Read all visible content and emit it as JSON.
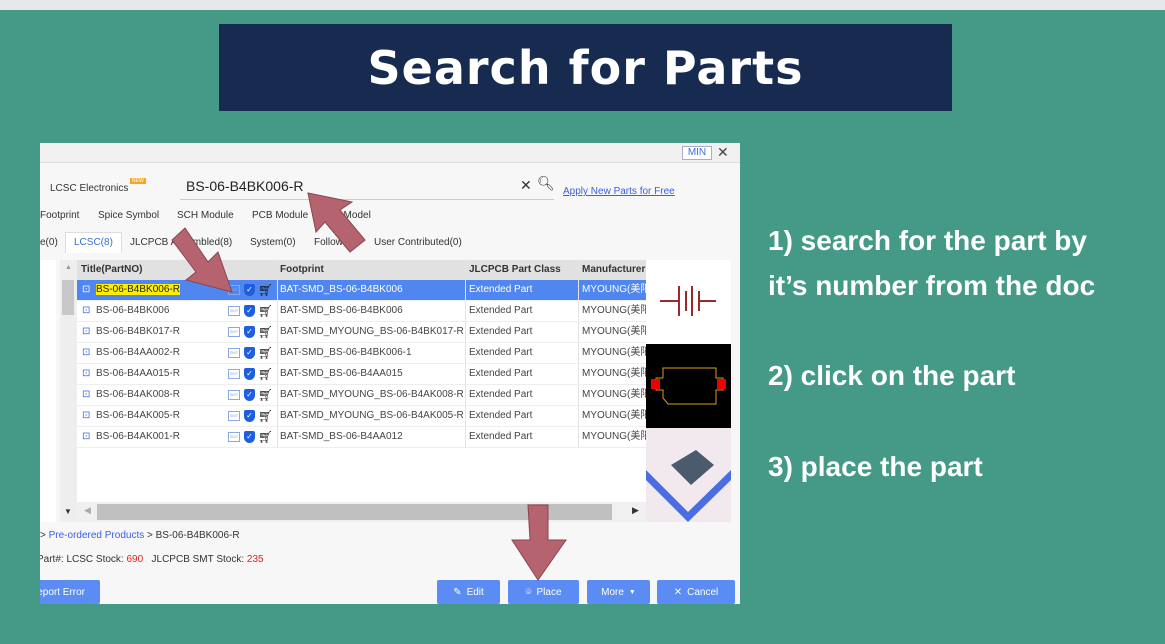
{
  "banner": {
    "title": "Search for Parts"
  },
  "dialog": {
    "min_label": "MIN",
    "close_label": "✕",
    "source_label": "LCSC Electronics",
    "new_badge": "NEW",
    "search_value": "BS-06-B4BK006-R",
    "apply_link": "Apply New Parts for Free",
    "type_tabs": [
      "Footprint",
      "Spice Symbol",
      "SCH Module",
      "PCB Module",
      "3D Model"
    ],
    "lib_tabs": [
      "e(0)",
      "LCSC(8)",
      "JLCPCB Assembled(8)",
      "System(0)",
      "Follow(0)",
      "User Contributed(0)"
    ],
    "columns": [
      "Title(PartNO)",
      "Footprint",
      "JLCPCB Part Class",
      "Manufacturer"
    ],
    "rows": [
      {
        "title": "BS-06-B4BK006-R",
        "footprint": "BAT-SMD_BS-06-B4BK006",
        "class": "Extended Part",
        "mfr": "MYOUNG(美阳)",
        "selected": true
      },
      {
        "title": "BS-06-B4BK006",
        "footprint": "BAT-SMD_BS-06-B4BK006",
        "class": "Extended Part",
        "mfr": "MYOUNG(美阳)"
      },
      {
        "title": "BS-06-B4BK017-R",
        "footprint": "BAT-SMD_MYOUNG_BS-06-B4BK017-R",
        "class": "Extended Part",
        "mfr": "MYOUNG(美阳)"
      },
      {
        "title": "BS-06-B4AA002-R",
        "footprint": "BAT-SMD_BS-06-B4BK006-1",
        "class": "Extended Part",
        "mfr": "MYOUNG(美阳)"
      },
      {
        "title": "BS-06-B4AA015-R",
        "footprint": "BAT-SMD_BS-06-B4AA015",
        "class": "Extended Part",
        "mfr": "MYOUNG(美阳)"
      },
      {
        "title": "BS-06-B4AK008-R",
        "footprint": "BAT-SMD_MYOUNG_BS-06-B4AK008-R",
        "class": "Extended Part",
        "mfr": "MYOUNG(美阳)"
      },
      {
        "title": "BS-06-B4AK005-R",
        "footprint": "BAT-SMD_MYOUNG_BS-06-B4AK005-R",
        "class": "Extended Part",
        "mfr": "MYOUNG(美阳)"
      },
      {
        "title": "BS-06-B4AK001-R",
        "footprint": "BAT-SMD_BS-06-B4AA012",
        "class": "Extended Part",
        "mfr": "MYOUNG(美阳)"
      }
    ],
    "smt_label": "SMT",
    "breadcrumb": {
      "sep": ">",
      "link": "Pre-ordered Products",
      "current": "BS-06-B4BK006-R"
    },
    "stock": {
      "prefix": "Part#: LCSC Stock:",
      "lcsc": "690",
      "jlc_label": "JLCPCB SMT Stock:",
      "jlc": "235"
    },
    "buttons": {
      "report": "Report Error",
      "edit": "Edit",
      "place": "Place",
      "more": "More",
      "cancel": "Cancel"
    }
  },
  "steps": [
    "1) search for the part by",
    "it’s number from the doc",
    "2) click on the part",
    "3) place the part"
  ],
  "colors": {
    "background": "#449a86",
    "banner": "#172a50",
    "arrow": "#b5646f",
    "selected_row": "#4f86f0",
    "button": "#5a8cf3"
  }
}
